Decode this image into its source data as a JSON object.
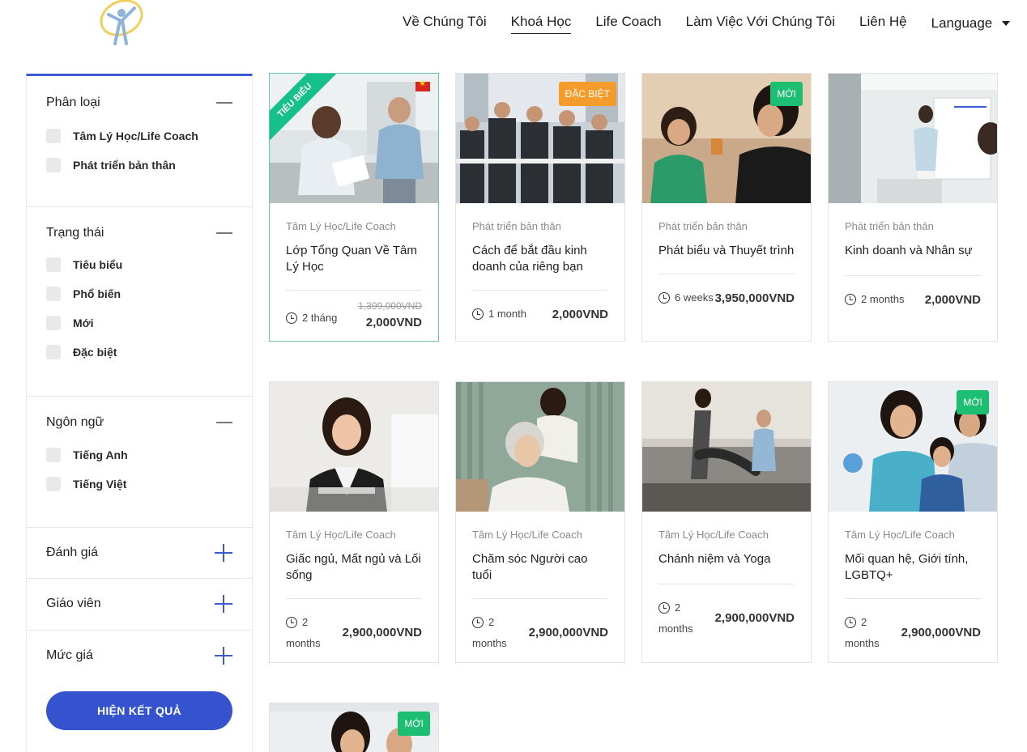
{
  "nav": {
    "items": [
      "Về Chúng Tôi",
      "Khoá Học",
      "Life Coach",
      "Làm Việc Với Chúng Tôi",
      "Liên Hệ"
    ],
    "language": "Language"
  },
  "sidebar": {
    "category": {
      "title": "Phân loại",
      "options": [
        "Tâm Lý Học/Life Coach",
        "Phát triển bản thân"
      ]
    },
    "status": {
      "title": "Trạng thái",
      "options": [
        "Tiêu biểu",
        "Phổ biến",
        "Mới",
        "Đặc biệt"
      ]
    },
    "language": {
      "title": "Ngôn ngữ",
      "options": [
        "Tiếng Anh",
        "Tiếng Việt"
      ]
    },
    "rating": {
      "title": "Đánh giá"
    },
    "teacher": {
      "title": "Giáo viên"
    },
    "price": {
      "title": "Mức giá"
    },
    "show_results": "HIỆN KẾT QUẢ"
  },
  "courses": [
    {
      "category": "Tâm Lý Học/Life Coach",
      "title": "Lớp Tổng Quan Về Tâm Lý Học",
      "duration": "2 tháng",
      "old_price": "1,399,000VND",
      "price": "2,000VND",
      "ribbon": "TIÊU BIỂU"
    },
    {
      "category": "Phát triển bản thân",
      "title": "Cách để bắt đầu kinh doanh của riêng bạn",
      "duration": "1 month",
      "price": "2,000VND",
      "badge": "ĐẶC BIỆT"
    },
    {
      "category": "Phát triển bản thân",
      "title": "Phát biểu và Thuyết trình",
      "duration": "6 weeks",
      "price": "3,950,000VND",
      "badge": "MỚI"
    },
    {
      "category": "Phát triển bản thân",
      "title": "Kinh doanh và Nhân sự",
      "duration": "2 months",
      "price": "2,000VND"
    },
    {
      "category": "Tâm Lý Học/Life Coach",
      "title": "Giấc ngủ, Mất ngủ và Lối sống",
      "duration_line1": "2",
      "duration_line2": "months",
      "price": "2,900,000VND"
    },
    {
      "category": "Tâm Lý Học/Life Coach",
      "title": "Chăm sóc Người cao tuổi",
      "duration_line1": "2",
      "duration_line2": "months",
      "price": "2,900,000VND"
    },
    {
      "category": "Tâm Lý Học/Life Coach",
      "title": "Chánh niệm và Yoga",
      "duration_line1": "2",
      "duration_line2": "months",
      "price": "2,900,000VND"
    },
    {
      "category": "Tâm Lý Học/Life Coach",
      "title": "Mối quan hệ, Giới tính, LGBTQ+",
      "duration_line1": "2",
      "duration_line2": "months",
      "price": "2,900,000VND",
      "badge": "MỚI"
    },
    {
      "badge": "MỚI"
    }
  ]
}
